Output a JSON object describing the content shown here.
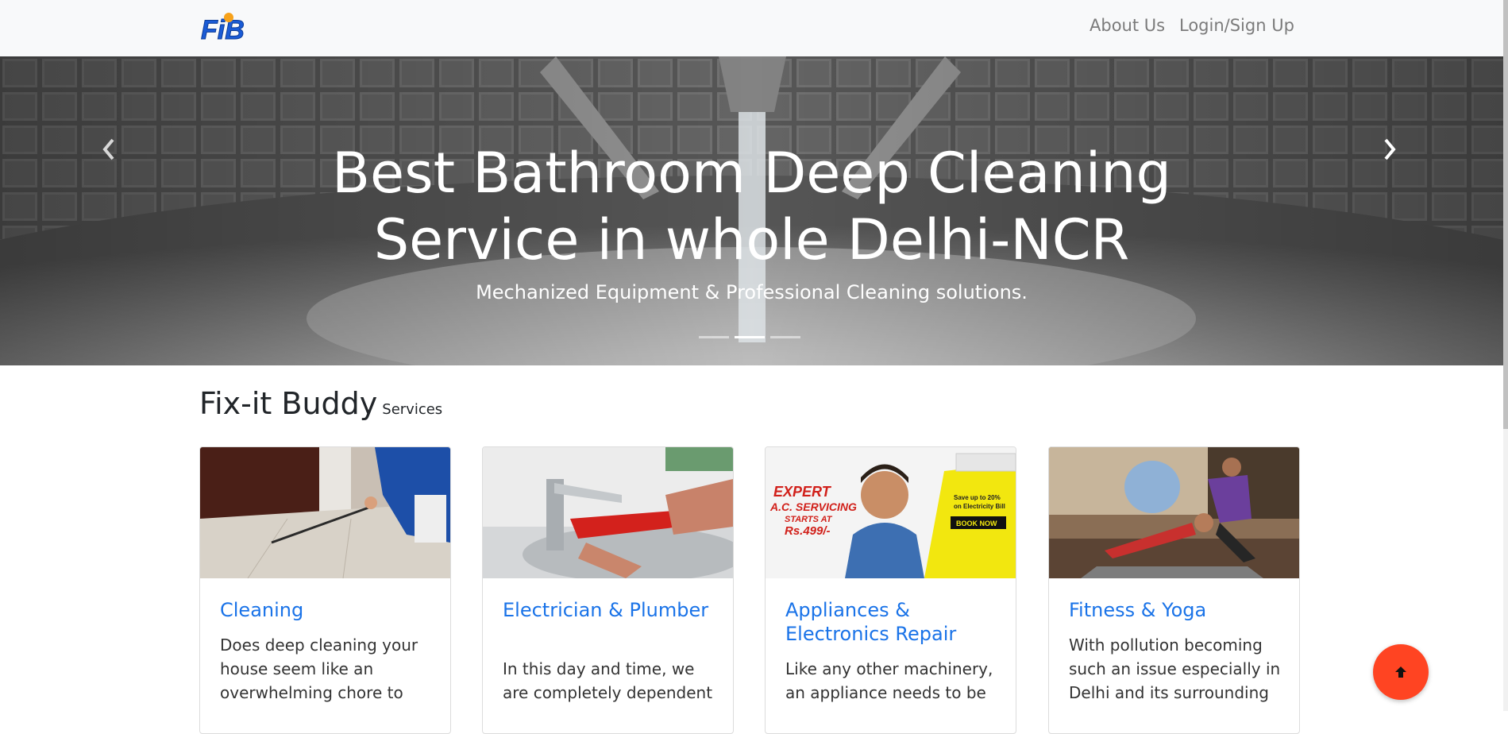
{
  "brand": {
    "logo_text": "FiB",
    "accent_color": "#1a5bd6",
    "dot_color": "#f7a21b"
  },
  "nav": {
    "items": [
      {
        "label": "About Us"
      },
      {
        "label": "Login/Sign Up"
      }
    ]
  },
  "hero": {
    "title_line1": "Best Bathroom Deep Cleaning",
    "title_line2": "Service in whole Delhi-NCR",
    "subtitle": "Mechanized Equipment & Professional Cleaning solutions.",
    "slides_count": 3,
    "active_slide": 2,
    "prev_icon": "chevron-left-icon",
    "next_icon": "chevron-right-icon"
  },
  "services": {
    "title": "Fix-it Buddy",
    "small": "Services",
    "cards": [
      {
        "title": "Cleaning",
        "text": "Does deep cleaning your house seem like an overwhelming chore to"
      },
      {
        "title": "Electrician & Plumber",
        "text": "In this day and time, we are completely dependent"
      },
      {
        "title": "Appliances & Electronics Repair",
        "text": "Like any other machinery, an appliance needs to be",
        "ad": {
          "headline1": "EXPERT",
          "headline2": "A.C. SERVICING",
          "headline3": "STARTS AT",
          "price": "Rs.499/-",
          "offer1": "Save up to 20%",
          "offer2": "on Electricity Bill",
          "cta": "BOOK NOW"
        }
      },
      {
        "title": "Fitness & Yoga",
        "text": "With pollution becoming such an issue especially in Delhi and its surrounding"
      }
    ]
  },
  "back_to_top": {
    "icon": "arrow-up-icon",
    "color": "#ff4422"
  }
}
